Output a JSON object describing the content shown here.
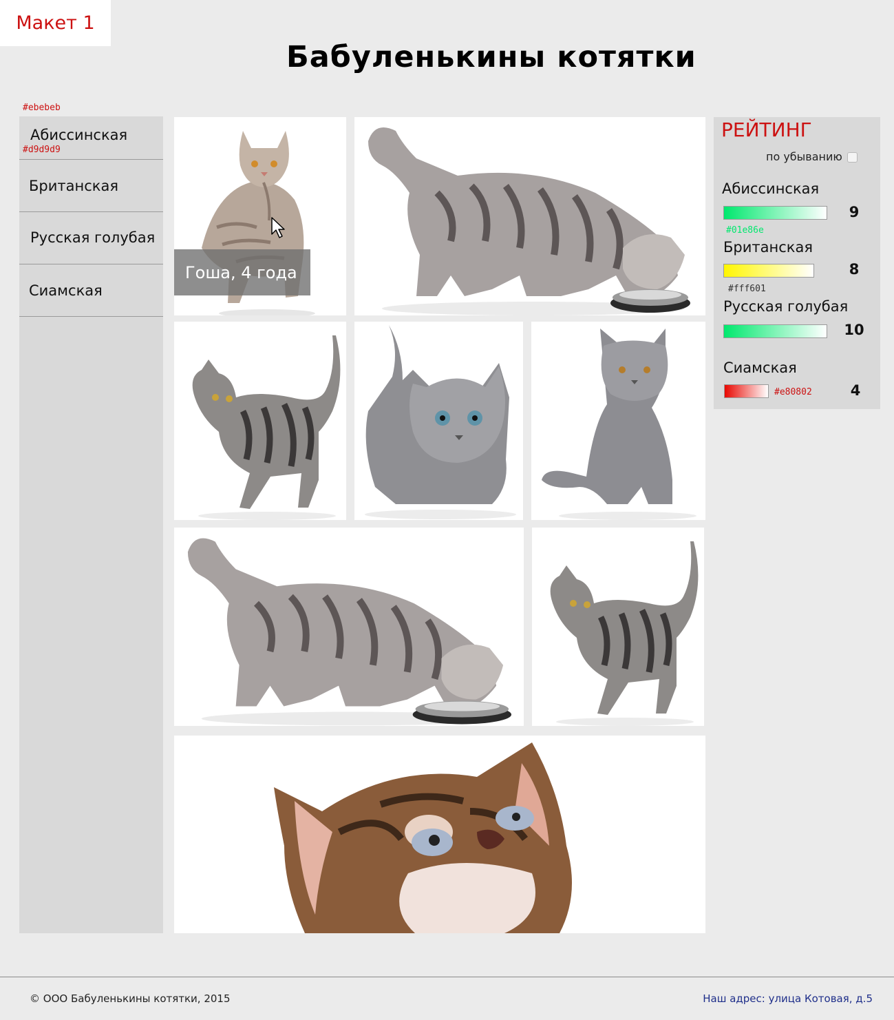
{
  "layout_label": "Макет 1",
  "title": "Бабуленькины котятки",
  "annotations": {
    "page_bg": "#ebebeb",
    "sidebar_bg": "#d9d9d9"
  },
  "sidebar": {
    "items": [
      {
        "label": "Абиссинская"
      },
      {
        "label": "Британская"
      },
      {
        "label": "Русская голубая"
      },
      {
        "label": "Сиамская"
      }
    ]
  },
  "gallery": {
    "caption": "Гоша, 4 года",
    "tiles": [
      {
        "icon": "cat-photo-icon"
      },
      {
        "icon": "cat-eating-photo-icon"
      },
      {
        "icon": "tabby-kitten-photo-icon"
      },
      {
        "icon": "grey-kitten-crouching-photo-icon"
      },
      {
        "icon": "grey-kitten-sitting-photo-icon"
      },
      {
        "icon": "cat-eating-photo-icon"
      },
      {
        "icon": "tabby-kitten-photo-icon"
      },
      {
        "icon": "kitten-face-photo-icon"
      }
    ]
  },
  "rating": {
    "title": "РЕЙТИНГ",
    "sort_label": "по убыванию",
    "sort_checked": false,
    "items": [
      {
        "name": "Абиссинская",
        "score": "9",
        "color": "#01e86e",
        "hex": "#01e86e",
        "hex_color": "#01e86e"
      },
      {
        "name": "Британская",
        "score": "8",
        "color": "#fff601",
        "hex": "#fff601",
        "hex_color": "#333333"
      },
      {
        "name": "Русская голубая",
        "score": "10",
        "color": "#01e86e",
        "hex": "",
        "hex_color": "#01e86e"
      },
      {
        "name": "Сиамская",
        "score": "4",
        "color": "#e80802",
        "hex": "#e80802",
        "hex_color": "#cc1111"
      }
    ]
  },
  "footer": {
    "copyright": "© ООО Бабуленькины котятки, 2015",
    "address": "Наш адрес: улица Котовая, д.5"
  },
  "colors": {
    "accent": "#cc1111",
    "link": "#1f2f8a"
  }
}
